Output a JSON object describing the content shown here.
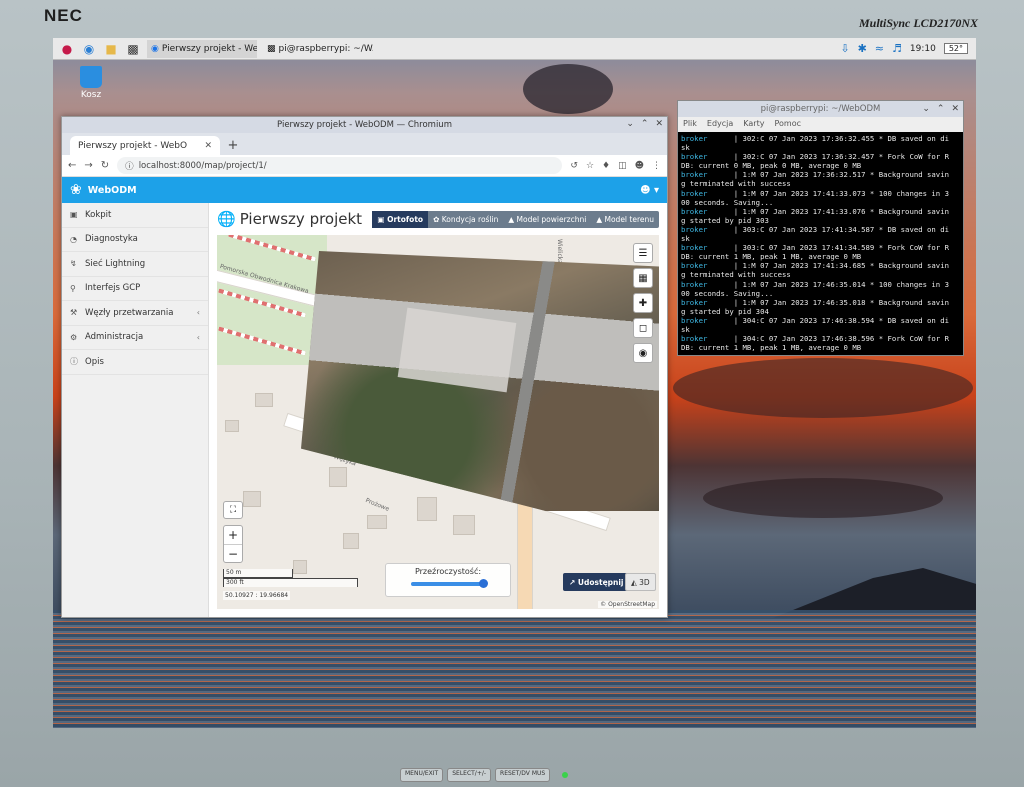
{
  "monitor": {
    "brand": "NEC",
    "model": "MultiSync LCD2170NX",
    "buttons": [
      "MENU/EXIT",
      "SELECT/+/-",
      "RESET/DV MUS"
    ]
  },
  "taskbar": {
    "tasks": [
      {
        "label": "Pierwszy projekt - We...",
        "icon": "chromium-icon",
        "active": true
      },
      {
        "label": "pi@raspberrypi: ~/W...",
        "icon": "terminal-icon",
        "active": false
      }
    ],
    "clock": "19:10",
    "cpu": "52°"
  },
  "desktop": {
    "trash_label": "Kosz"
  },
  "chromium": {
    "window_title": "Pierwszy projekt - WebODM — Chromium",
    "tab_title": "Pierwszy projekt - WebO",
    "url": "localhost:8000/map/project/1/"
  },
  "webodm": {
    "brand": "WebODM",
    "sidebar": [
      {
        "label": "Kokpit",
        "icon": "dashboard-icon",
        "has_arrow": false
      },
      {
        "label": "Diagnostyka",
        "icon": "pie-chart-icon",
        "has_arrow": false
      },
      {
        "label": "Sieć Lightning",
        "icon": "bolt-icon",
        "has_arrow": false
      },
      {
        "label": "Interfejs GCP",
        "icon": "map-marker-icon",
        "has_arrow": false
      },
      {
        "label": "Węzły przetwarzania",
        "icon": "wrench-icon",
        "has_arrow": true
      },
      {
        "label": "Administracja",
        "icon": "cogs-icon",
        "has_arrow": true
      },
      {
        "label": "Opis",
        "icon": "info-icon",
        "has_arrow": false
      }
    ],
    "project_title": "Pierwszy projekt",
    "view_tabs": [
      {
        "label": "Ortofoto",
        "active": true
      },
      {
        "label": "Kondycja roślin",
        "active": false
      },
      {
        "label": "Model powierzchni",
        "active": false
      },
      {
        "label": "Model terenu",
        "active": false
      }
    ],
    "map": {
      "street_labels": [
        "Pomorska Obwodnica Krakowa",
        "Wężyka",
        "Wielicka",
        "Prożowe"
      ],
      "scale_metric": "50 m",
      "scale_imperial": "300 ft",
      "coordinates": "50.10927 : 19.96684",
      "opacity_label": "Przeźroczystość:",
      "opacity_value": 1.0,
      "share_label": "Udostępnij",
      "btn_3d": "3D",
      "attribution": "© OpenStreetMap"
    }
  },
  "terminal": {
    "title": "pi@raspberrypi: ~/WebODM",
    "menu": [
      "Plik",
      "Edycja",
      "Karty",
      "Pomoc"
    ],
    "lines": [
      [
        "broker",
        "      | 302:C 07 Jan 2023 17:36:32.455 * DB saved on di"
      ],
      [
        "",
        "sk"
      ],
      [
        "broker",
        "      | 302:C 07 Jan 2023 17:36:32.457 * Fork CoW for R"
      ],
      [
        "",
        "DB: current 0 MB, peak 0 MB, average 0 MB"
      ],
      [
        "broker",
        "      | 1:M 07 Jan 2023 17:36:32.517 * Background savin"
      ],
      [
        "",
        "g terminated with success"
      ],
      [
        "broker",
        "      | 1:M 07 Jan 2023 17:41:33.073 * 100 changes in 3"
      ],
      [
        "",
        "00 seconds. Saving..."
      ],
      [
        "broker",
        "      | 1:M 07 Jan 2023 17:41:33.076 * Background savin"
      ],
      [
        "",
        "g started by pid 303"
      ],
      [
        "broker",
        "      | 303:C 07 Jan 2023 17:41:34.587 * DB saved on di"
      ],
      [
        "",
        "sk"
      ],
      [
        "broker",
        "      | 303:C 07 Jan 2023 17:41:34.589 * Fork CoW for R"
      ],
      [
        "",
        "DB: current 1 MB, peak 1 MB, average 0 MB"
      ],
      [
        "broker",
        "      | 1:M 07 Jan 2023 17:41:34.685 * Background savin"
      ],
      [
        "",
        "g terminated with success"
      ],
      [
        "broker",
        "      | 1:M 07 Jan 2023 17:46:35.014 * 100 changes in 3"
      ],
      [
        "",
        "00 seconds. Saving..."
      ],
      [
        "broker",
        "      | 1:M 07 Jan 2023 17:46:35.018 * Background savin"
      ],
      [
        "",
        "g started by pid 304"
      ],
      [
        "broker",
        "      | 304:C 07 Jan 2023 17:46:38.594 * DB saved on di"
      ],
      [
        "",
        "sk"
      ],
      [
        "broker",
        "      | 304:C 07 Jan 2023 17:46:38.596 * Fork CoW for R"
      ],
      [
        "",
        "DB: current 1 MB, peak 1 MB, average 0 MB"
      ]
    ]
  }
}
